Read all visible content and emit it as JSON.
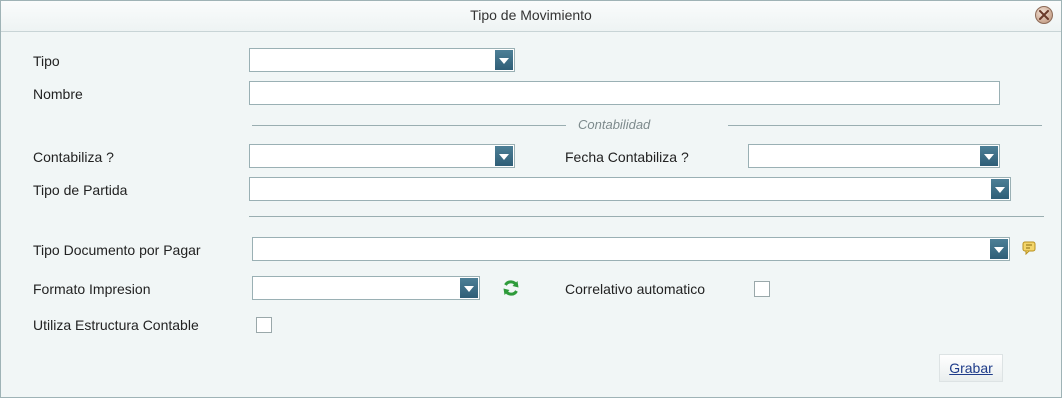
{
  "window": {
    "title": "Tipo de Movimiento"
  },
  "form": {
    "tipo_label": "Tipo",
    "nombre_label": "Nombre",
    "contabilidad_legend": "Contabilidad",
    "contabiliza_label": "Contabiliza ?",
    "fecha_contabiliza_label": "Fecha Contabiliza ?",
    "tipo_partida_label": "Tipo de Partida",
    "tipo_documento_label": "Tipo Documento por Pagar",
    "formato_impresion_label": "Formato Impresion",
    "correlativo_label": "Correlativo automatico",
    "utiliza_estructura_label": "Utiliza Estructura Contable",
    "tipo_value": "",
    "nombre_value": "",
    "contabiliza_value": "",
    "fecha_contabiliza_value": "",
    "tipo_partida_value": "",
    "tipo_documento_value": "",
    "formato_impresion_value": "",
    "correlativo_checked": false,
    "utiliza_estructura_checked": false
  },
  "actions": {
    "save_label": "Grabar"
  },
  "icons": {
    "close": "close-icon",
    "dropdown": "chevron-down-icon",
    "refresh": "refresh-icon",
    "note": "note-icon"
  },
  "colors": {
    "background": "#f1f6f6",
    "dropdown_button": "#3a6d86",
    "refresh_green": "#2e9b3a",
    "note_yellow": "#e8c34a",
    "link_blue": "#1f3c8a"
  }
}
